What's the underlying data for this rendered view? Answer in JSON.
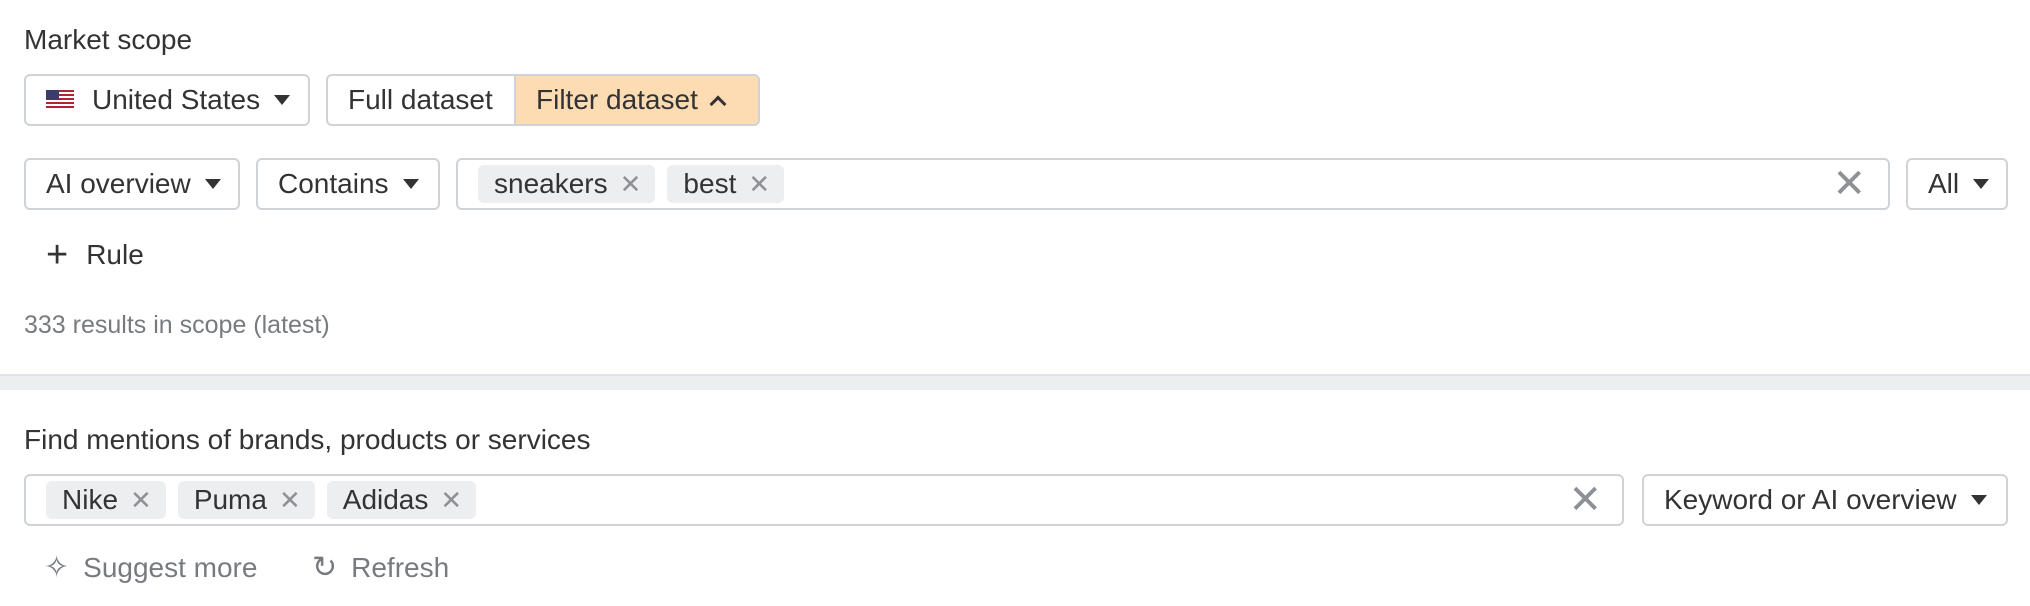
{
  "market_scope": {
    "heading": "Market scope",
    "country": {
      "label": "United States",
      "flag_icon": "us-flag-icon"
    },
    "dataset_toggle": {
      "full_label": "Full dataset",
      "filter_label": "Filter dataset",
      "active": "filter",
      "active_color": "#fddcb3"
    },
    "rule": {
      "field": "AI overview",
      "operator": "Contains",
      "terms": [
        "sneakers",
        "best"
      ],
      "match": "All"
    },
    "add_rule_label": "Rule",
    "results_text": "333 results in scope (latest)"
  },
  "mentions": {
    "heading": "Find mentions of brands, products or services",
    "terms": [
      "Nike",
      "Puma",
      "Adidas"
    ],
    "scope": "Keyword or AI overview",
    "suggest_label": "Suggest more",
    "refresh_label": "Refresh"
  }
}
